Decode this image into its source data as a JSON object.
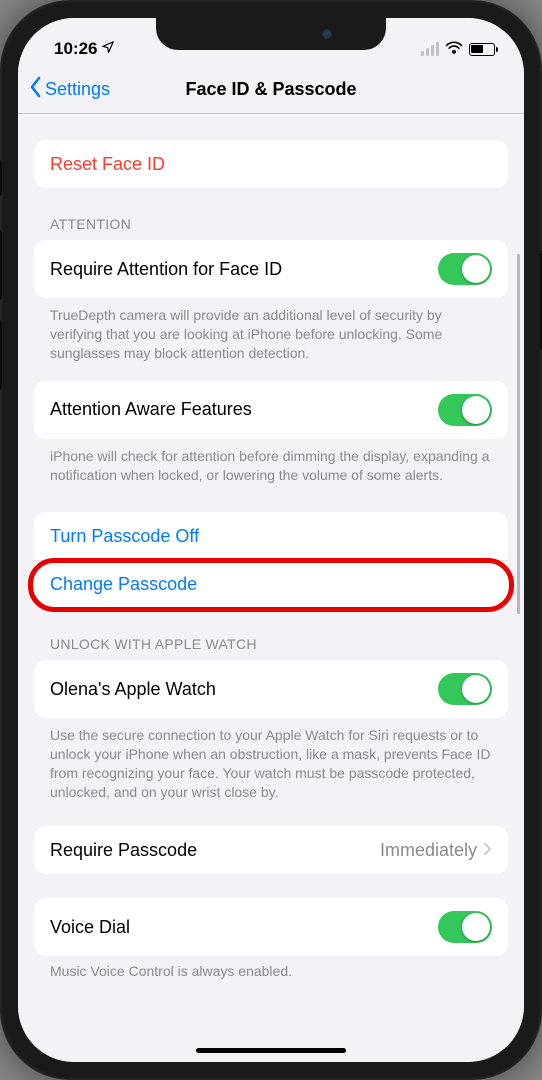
{
  "status": {
    "time": "10:26"
  },
  "nav": {
    "back": "Settings",
    "title": "Face ID & Passcode"
  },
  "reset": {
    "label": "Reset Face ID"
  },
  "attention": {
    "header": "ATTENTION",
    "require_label": "Require Attention for Face ID",
    "require_footer": "TrueDepth camera will provide an additional level of security by verifying that you are looking at iPhone before unlocking. Some sunglasses may block attention detection.",
    "aware_label": "Attention Aware Features",
    "aware_footer": "iPhone will check for attention before dimming the display, expanding a notification when locked, or lowering the volume of some alerts."
  },
  "passcode": {
    "turn_off": "Turn Passcode Off",
    "change": "Change Passcode"
  },
  "watch": {
    "header": "UNLOCK WITH APPLE WATCH",
    "item_label": "Olena's Apple Watch",
    "footer": "Use the secure connection to your Apple Watch for Siri requests or to unlock your iPhone when an obstruction, like a mask, prevents Face ID from recognizing your face. Your watch must be passcode protected, unlocked, and on your wrist close by."
  },
  "require_passcode": {
    "label": "Require Passcode",
    "value": "Immediately"
  },
  "voice_dial": {
    "label": "Voice Dial",
    "footer": "Music Voice Control is always enabled."
  }
}
